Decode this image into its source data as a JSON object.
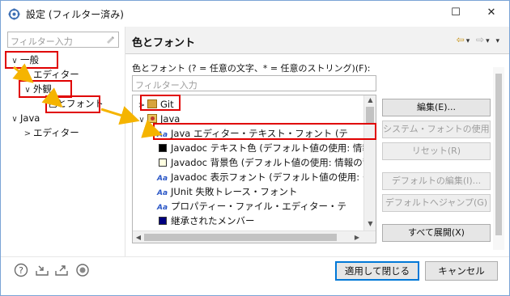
{
  "window": {
    "title": "設定 (フィルター済み)",
    "min_glyph": "—",
    "max_glyph": "☐",
    "close_glyph": "✕"
  },
  "left": {
    "filter_placeholder": "フィルター入力",
    "tree": [
      {
        "label": "一般",
        "twisty": "∨"
      },
      {
        "label": "エディター",
        "twisty": ""
      },
      {
        "label": "外観",
        "twisty": "∨"
      },
      {
        "label": "色とフォント",
        "twisty": ""
      },
      {
        "label": "Java",
        "twisty": "∨"
      },
      {
        "label": "エディター",
        "twisty": ">"
      }
    ]
  },
  "right": {
    "title": "色とフォント",
    "description": "色とフォント (? = 任意の文字、* = 任意のストリング)(F):",
    "filter_placeholder": "フィルター入力",
    "items": [
      {
        "label": "Git",
        "twisty": ">",
        "icon": "folder-icon"
      },
      {
        "label": "Java",
        "twisty": "∨",
        "icon": "java-folder-icon"
      },
      {
        "label": "Java エディター・テキスト・フォント (テ",
        "icon": "font-icon",
        "glyph": "Aa"
      },
      {
        "label": "Javadoc テキスト色 (デフォルト値の使用: 情報のテ",
        "icon": "color-swatch",
        "color": "#000000"
      },
      {
        "label": "Javadoc 背景色 (デフォルト値の使用: 情報の背景",
        "icon": "color-swatch",
        "color": "#ffffe1"
      },
      {
        "label": "Javadoc 表示フォント (デフォルト値の使用: ダイアロ",
        "icon": "font-icon",
        "glyph": "Aa"
      },
      {
        "label": "JUnit 失敗トレース・フォント",
        "icon": "font-icon",
        "glyph": "Aa"
      },
      {
        "label": "プロパティー・ファイル・エディター・テ",
        "icon": "font-icon",
        "glyph": "Aa"
      },
      {
        "label": "継承されたメンバー",
        "icon": "color-swatch",
        "color": "#000080"
      }
    ],
    "buttons": {
      "edit": "編集(E)...",
      "use_system_font": "システム・フォントの使用(U)",
      "reset": "リセット(R)",
      "edit_default": "デフォルトの編集(I)...",
      "goto_default": "デフォルトへジャンプ(G)",
      "expand_all": "すべて展開(X)"
    }
  },
  "footer": {
    "apply_close": "適用して閉じる",
    "cancel": "キャンセル"
  },
  "colors": {
    "annotation_red": "#e00000",
    "annotation_arrow": "#f5b400",
    "accent": "#0078d7"
  }
}
